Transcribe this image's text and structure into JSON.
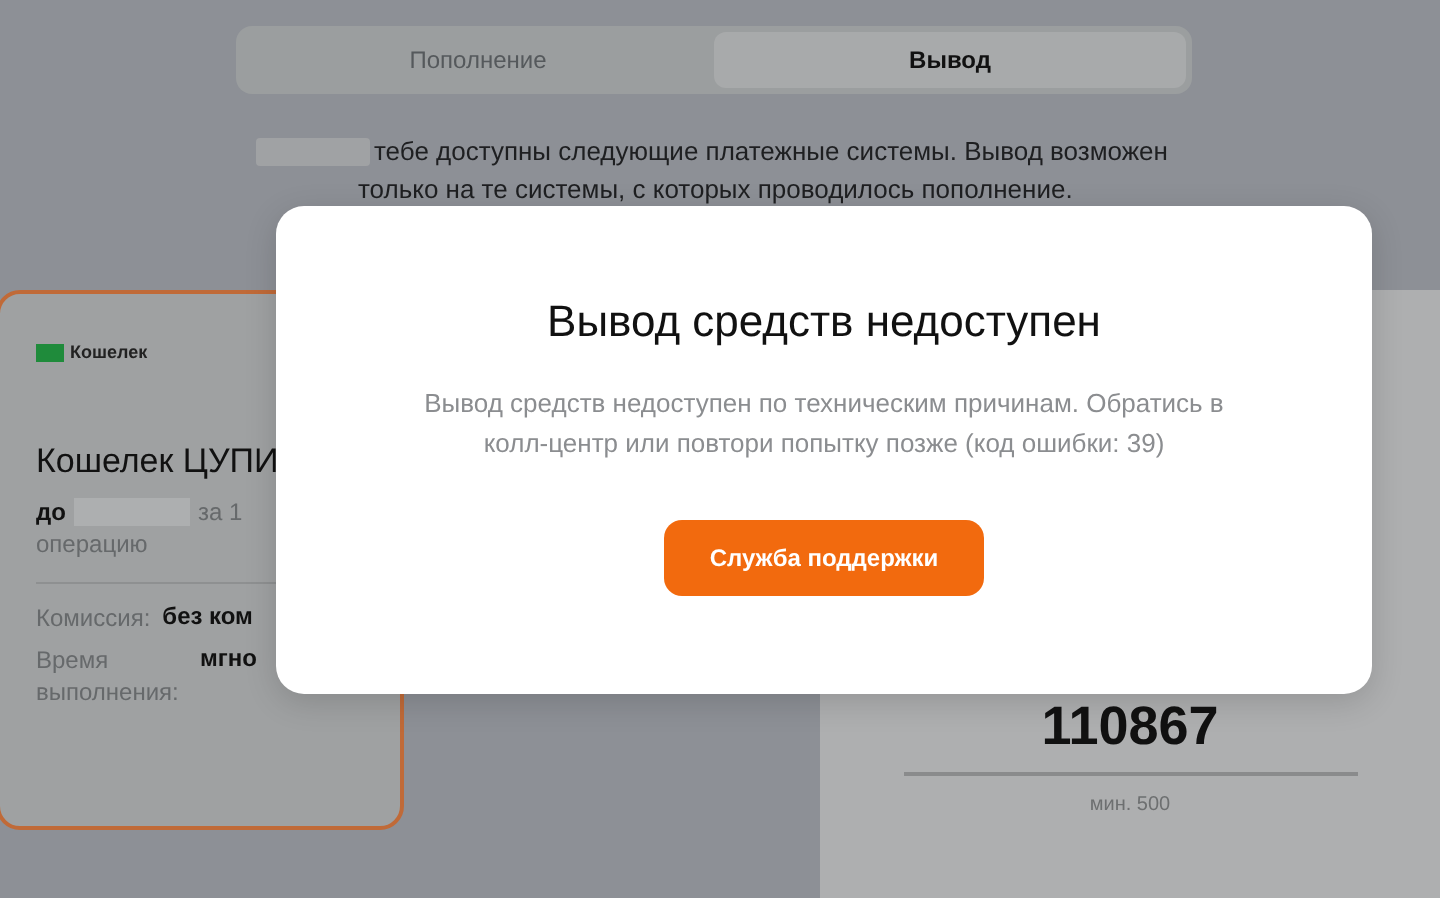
{
  "tabs": [
    {
      "label": "Пополнение",
      "selected": false
    },
    {
      "label": "Вывод",
      "selected": true
    }
  ],
  "notice": {
    "text_line_1": "тебе доступны следующие платежные системы. Вывод возможен",
    "text_line_2": "только на те системы, с которых проводилось пополнение."
  },
  "payment_card": {
    "selected": true,
    "logo": "Кошелек",
    "title": "Кошелек ЦУПИ",
    "limit_prefix": "до",
    "limit_suffix": "за 1",
    "limit_line_2": "операцию",
    "details": [
      {
        "label": "Комиссия:",
        "value": "без ком"
      },
      {
        "label": "Время выполнения:",
        "value": "мгно"
      }
    ]
  },
  "amount_panel": {
    "amount": "110867",
    "hint": "мин. 500"
  },
  "modal": {
    "title": "Вывод средств недоступен",
    "message": "Вывод средств недоступен по техническим причинам. Обратись в колл-центр или повтори попытку позже (код ошибки: 39)",
    "button": "Служба поддержки"
  }
}
